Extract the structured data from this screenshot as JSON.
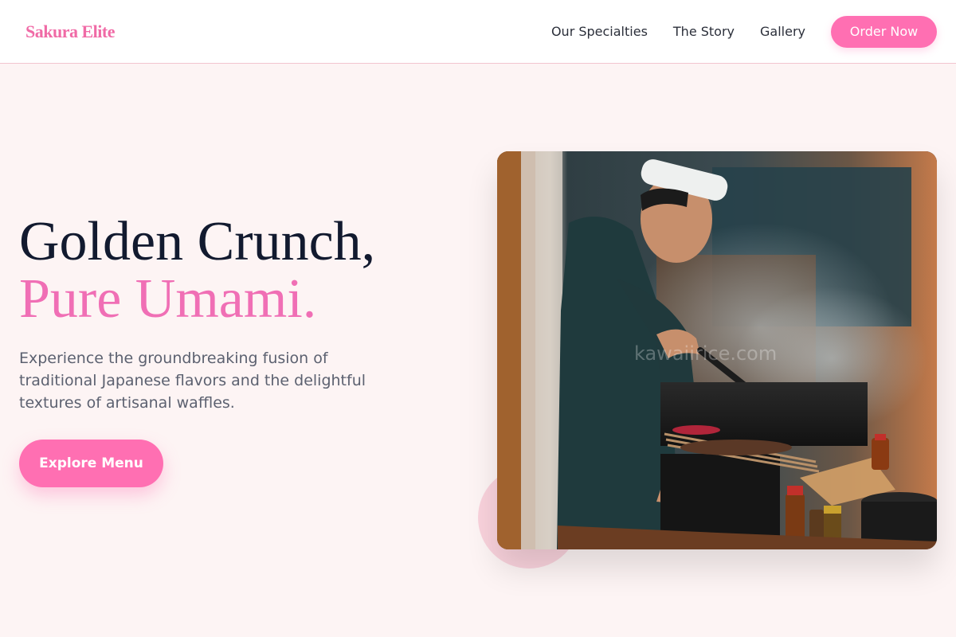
{
  "header": {
    "logo": "Sakura Elite",
    "nav": [
      "Our Specialties",
      "The Story",
      "Gallery"
    ],
    "cta_label": "Order Now"
  },
  "hero": {
    "headline_line1": "Golden Crunch,",
    "headline_line2": "Pure Umami.",
    "description": "Experience the groundbreaking fusion of traditional Japanese flavors and the delightful textures of artisanal waffles.",
    "button_label": "Explore Menu",
    "image_watermark": "kawaiirice.com"
  },
  "colors": {
    "brand_pink": "#ff6fb2",
    "headline_dark": "#121a2f",
    "page_background": "#fdf4f4"
  }
}
